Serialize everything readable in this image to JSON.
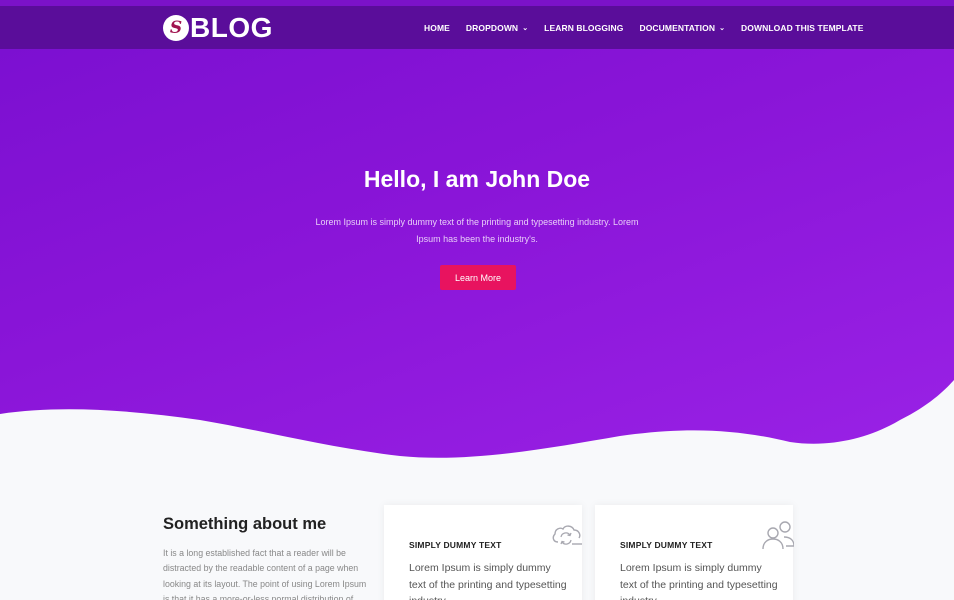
{
  "brand": {
    "mark": "S",
    "name": "BLOG"
  },
  "nav": {
    "home": "HOME",
    "dropdown": "DROPDOWN",
    "learn": "LEARN BLOGGING",
    "docs": "DOCUMENTATION",
    "download": "DOWNLOAD THIS TEMPLATE",
    "caret": "⌄"
  },
  "hero": {
    "title": "Hello, I am John Doe",
    "text": "Lorem Ipsum is simply dummy text of the printing and typesetting industry. Lorem Ipsum has been the industry's.",
    "button": "Learn More"
  },
  "about": {
    "title": "Something about me",
    "text": "It is a long established fact that a reader will be distracted by the readable content of a page when looking at its layout. The point of using Lorem Ipsum is that it has a more-or-less normal distribution of"
  },
  "cards": [
    {
      "title": "SIMPLY DUMMY TEXT",
      "text": "Lorem Ipsum is simply dummy text of the printing and typesetting industry.",
      "icon": "cloud-sync-icon"
    },
    {
      "title": "SIMPLY DUMMY TEXT",
      "text": "Lorem Ipsum is simply dummy text of the printing and typesetting industry.",
      "icon": "users-icon"
    }
  ],
  "colors": {
    "hero": "#8a15d8",
    "navbar": "#5a0d9a",
    "accent": "#e8135f"
  }
}
